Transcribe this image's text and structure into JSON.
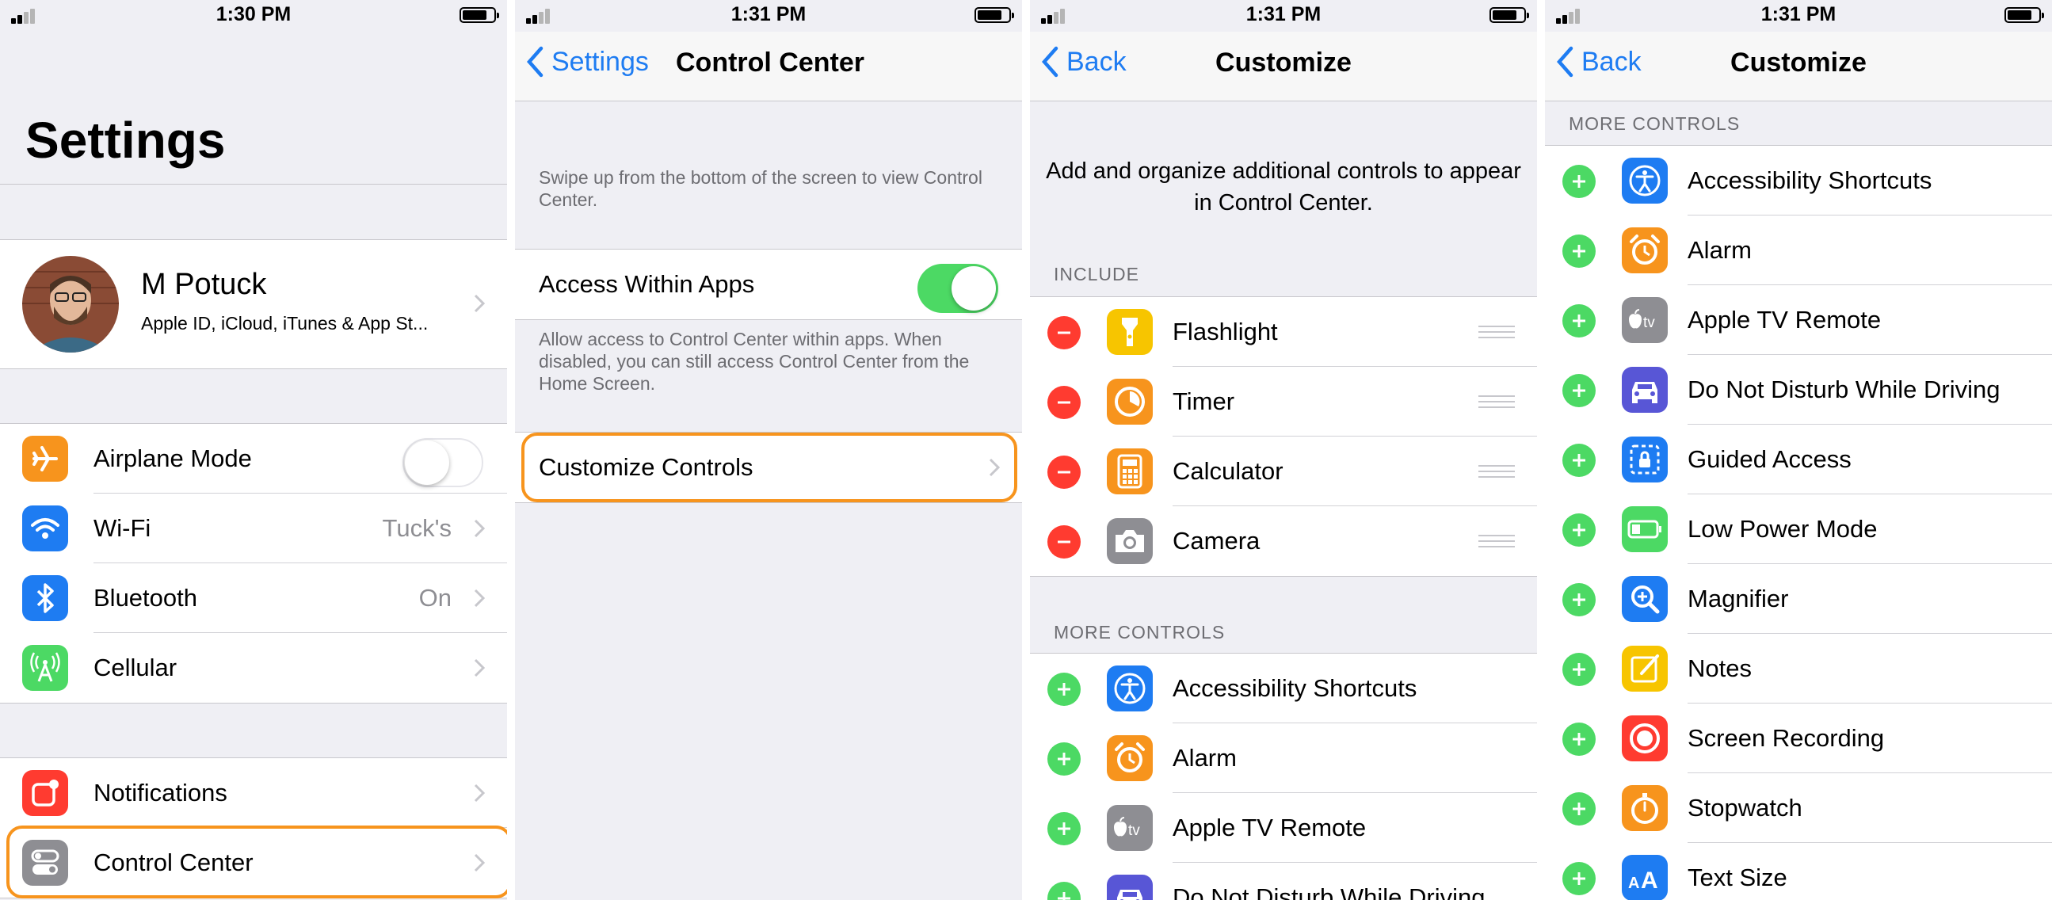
{
  "panels": [
    {
      "time": "1:30 PM",
      "title": "Settings",
      "profile": {
        "name": "M Potuck",
        "subtitle": "Apple ID, iCloud, iTunes & App St..."
      },
      "group1": [
        {
          "label": "Airplane Mode",
          "icon": "airplane-icon",
          "color": "#f7941d",
          "toggle": "off"
        },
        {
          "label": "Wi-Fi",
          "icon": "wifi-icon",
          "color": "#1e7cf2",
          "value": "Tuck's"
        },
        {
          "label": "Bluetooth",
          "icon": "bluetooth-icon",
          "color": "#1e7cf2",
          "value": "On"
        },
        {
          "label": "Cellular",
          "icon": "cellular-icon",
          "color": "#4cd964",
          "value": ""
        }
      ],
      "group2": [
        {
          "label": "Notifications",
          "icon": "notifications-icon",
          "color": "#ff3b30"
        },
        {
          "label": "Control Center",
          "icon": "control-center-icon",
          "color": "#8e8e93"
        }
      ]
    },
    {
      "time": "1:31 PM",
      "back": "Settings",
      "title": "Control Center",
      "hint1": "Swipe up from the bottom of the screen to view Control Center.",
      "toggle_label": "Access Within Apps",
      "toggle_state": "on",
      "hint2": "Allow access to Control Center within apps. When disabled, you can still access Control Center from the Home Screen.",
      "customize": "Customize Controls"
    },
    {
      "time": "1:31 PM",
      "back": "Back",
      "title": "Customize",
      "intro": "Add and organize additional controls to appear in Control Center.",
      "include_header": "INCLUDE",
      "include": [
        {
          "label": "Flashlight",
          "icon": "flashlight-icon",
          "color": "#f7c500"
        },
        {
          "label": "Timer",
          "icon": "timer-icon",
          "color": "#f7941d"
        },
        {
          "label": "Calculator",
          "icon": "calculator-icon",
          "color": "#f7941d"
        },
        {
          "label": "Camera",
          "icon": "camera-icon",
          "color": "#8e8e93"
        }
      ],
      "more_header": "MORE CONTROLS",
      "more": [
        {
          "label": "Accessibility Shortcuts",
          "icon": "accessibility-icon",
          "color": "#1e7cf2"
        },
        {
          "label": "Alarm",
          "icon": "alarm-icon",
          "color": "#f7941d"
        },
        {
          "label": "Apple TV Remote",
          "icon": "apple-tv-icon",
          "color": "#8e8e93"
        },
        {
          "label": "Do Not Disturb While Driving",
          "icon": "car-icon",
          "color": "#5856d6"
        }
      ]
    },
    {
      "time": "1:31 PM",
      "back": "Back",
      "title": "Customize",
      "more_header": "MORE CONTROLS",
      "more": [
        {
          "label": "Accessibility Shortcuts",
          "icon": "accessibility-icon",
          "color": "#1e7cf2"
        },
        {
          "label": "Alarm",
          "icon": "alarm-icon",
          "color": "#f7941d"
        },
        {
          "label": "Apple TV Remote",
          "icon": "apple-tv-icon",
          "color": "#8e8e93"
        },
        {
          "label": "Do Not Disturb While Driving",
          "icon": "car-icon",
          "color": "#5856d6"
        },
        {
          "label": "Guided Access",
          "icon": "guided-access-icon",
          "color": "#1e7cf2"
        },
        {
          "label": "Low Power Mode",
          "icon": "battery-icon",
          "color": "#4cd964"
        },
        {
          "label": "Magnifier",
          "icon": "magnifier-icon",
          "color": "#1e7cf2"
        },
        {
          "label": "Notes",
          "icon": "notes-icon",
          "color": "#f7c500"
        },
        {
          "label": "Screen Recording",
          "icon": "screen-recording-icon",
          "color": "#ff3b30"
        },
        {
          "label": "Stopwatch",
          "icon": "stopwatch-icon",
          "color": "#f7941d"
        },
        {
          "label": "Text Size",
          "icon": "text-size-icon",
          "color": "#1e7cf2"
        }
      ]
    }
  ],
  "colors": {
    "tint": "#1e7cf2",
    "highlight": "#f7941d",
    "add": "#4cd964",
    "remove": "#ff3b30"
  }
}
